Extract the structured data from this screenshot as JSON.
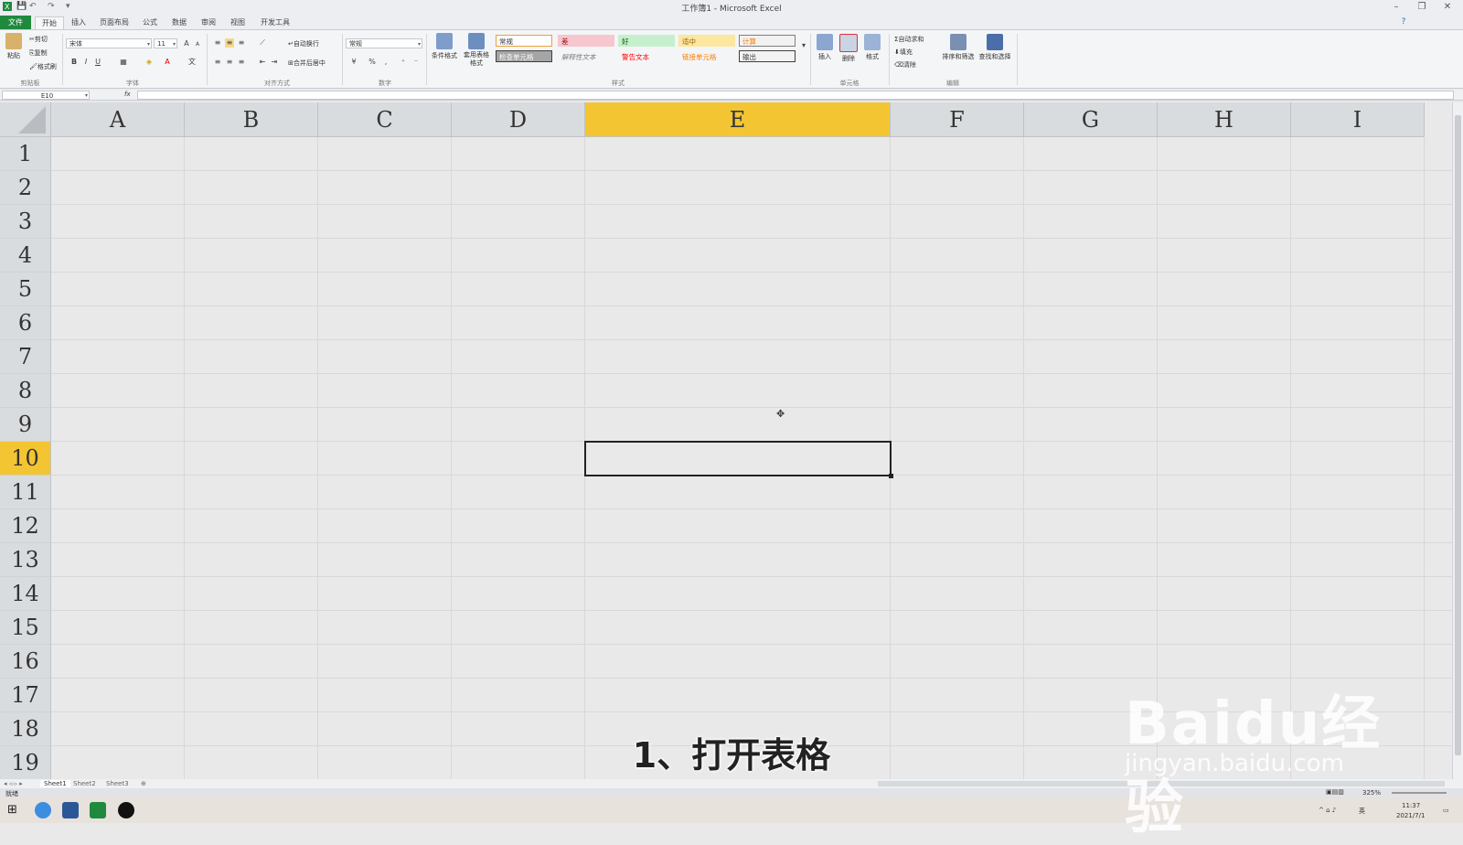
{
  "window": {
    "title": "工作簿1 - Microsoft Excel",
    "controls": [
      "–",
      "❐",
      "✕"
    ]
  },
  "tabs": [
    {
      "label": "文件",
      "kind": "file"
    },
    {
      "label": "开始",
      "kind": "active"
    },
    {
      "label": "插入",
      "kind": ""
    },
    {
      "label": "页面布局",
      "kind": ""
    },
    {
      "label": "公式",
      "kind": ""
    },
    {
      "label": "数据",
      "kind": ""
    },
    {
      "label": "审阅",
      "kind": ""
    },
    {
      "label": "视图",
      "kind": ""
    },
    {
      "label": "开发工具",
      "kind": ""
    }
  ],
  "ribbon": {
    "clipboard": {
      "paste": "粘贴",
      "cut": "剪切",
      "copy": "复制",
      "format_painter": "格式刷",
      "label": "剪贴板"
    },
    "font": {
      "name": "宋体",
      "size": "11",
      "label": "字体",
      "bold": "B",
      "italic": "I",
      "underline": "U"
    },
    "alignment": {
      "wrap": "自动换行",
      "merge": "合并后居中",
      "label": "对齐方式"
    },
    "number": {
      "format": "常规",
      "label": "数字",
      "percent": "%"
    },
    "styles": {
      "conditional": "条件格式",
      "table": "套用表格格式",
      "label": "样式",
      "cells": [
        {
          "text": "常规",
          "bg": "#ffffff",
          "color": "#333333",
          "border": "#e8a23a"
        },
        {
          "text": "差",
          "bg": "#f6c7ce",
          "color": "#9c0006",
          "border": "#f6c7ce"
        },
        {
          "text": "好",
          "bg": "#c6efce",
          "color": "#006100",
          "border": "#c6efce"
        },
        {
          "text": "适中",
          "bg": "#fbe7a0",
          "color": "#9c6500",
          "border": "#fbe7a0"
        },
        {
          "text": "计算",
          "bg": "#f2f2f2",
          "color": "#fa7d00",
          "border": "#7f7f7f"
        },
        {
          "text": "检查单元格",
          "bg": "#a5a5a5",
          "color": "#ffffff",
          "border": "#3f3f3f"
        },
        {
          "text": "解释性文本",
          "bg": "#f4f5f7",
          "color": "#7f7f7f",
          "border": "#f4f5f7"
        },
        {
          "text": "警告文本",
          "bg": "#f4f5f7",
          "color": "#ff0000",
          "border": "#f4f5f7"
        },
        {
          "text": "链接单元格",
          "bg": "#f4f5f7",
          "color": "#fa7d00",
          "border": "#f4f5f7"
        },
        {
          "text": "输出",
          "bg": "#f2f2f2",
          "color": "#3f3f3f",
          "border": "#3f3f3f"
        }
      ]
    },
    "cells": {
      "insert": "插入",
      "delete": "删除",
      "format": "格式",
      "label": "单元格"
    },
    "editing": {
      "autosum": "自动求和",
      "fill": "填充",
      "clear": "清除",
      "sort": "排序和筛选",
      "find": "查找和选择",
      "label": "编辑"
    }
  },
  "formula_bar": {
    "name_box": "E10",
    "fx": "fx",
    "value": ""
  },
  "grid": {
    "columns": [
      "A",
      "B",
      "C",
      "D",
      "E",
      "F",
      "G",
      "H",
      "I"
    ],
    "rows": [
      "1",
      "2",
      "3",
      "4",
      "5",
      "6",
      "7",
      "8",
      "9",
      "10",
      "11",
      "12",
      "13",
      "14",
      "15",
      "16",
      "17",
      "18",
      "19"
    ],
    "selected_column": "E",
    "selected_row": "10",
    "accent": "#f3c532"
  },
  "sheets": [
    "Sheet1",
    "Sheet2",
    "Sheet3"
  ],
  "status": {
    "ready": "就绪",
    "zoom": "325%"
  },
  "taskbar": {
    "time": "11:37",
    "date": "2021/7/1",
    "ime": "英"
  },
  "overlay": {
    "subtitle": "1、打开表格",
    "watermark": "Baidu经验",
    "watermark_url": "jingyan.baidu.com"
  }
}
